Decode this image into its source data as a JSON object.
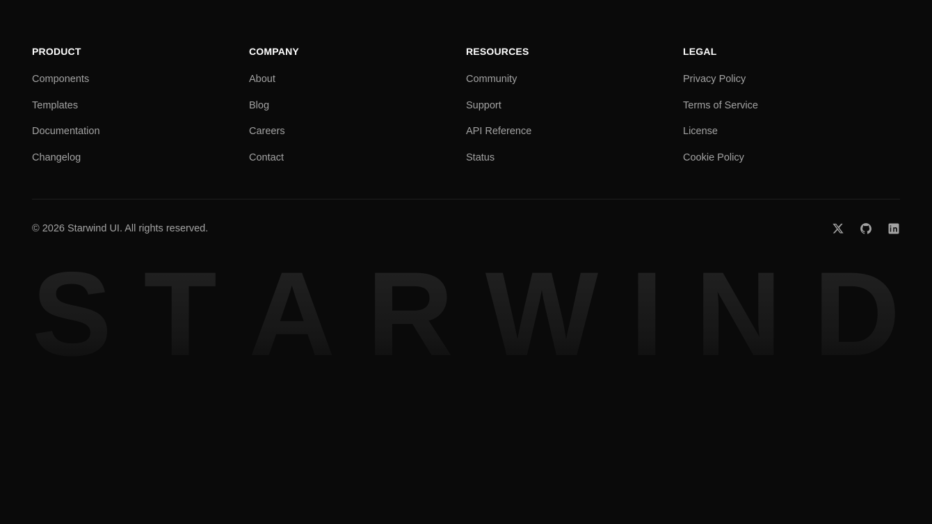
{
  "columns": [
    {
      "heading": "PRODUCT",
      "links": [
        "Components",
        "Templates",
        "Documentation",
        "Changelog"
      ]
    },
    {
      "heading": "COMPANY",
      "links": [
        "About",
        "Blog",
        "Careers",
        "Contact"
      ]
    },
    {
      "heading": "RESOURCES",
      "links": [
        "Community",
        "Support",
        "API Reference",
        "Status"
      ]
    },
    {
      "heading": "LEGAL",
      "links": [
        "Privacy Policy",
        "Terms of Service",
        "License",
        "Cookie Policy"
      ]
    }
  ],
  "copyright": "© 2026 Starwind UI. All rights reserved.",
  "socials": [
    {
      "icon": "x-icon"
    },
    {
      "icon": "github-icon"
    },
    {
      "icon": "linkedin-icon"
    }
  ],
  "wordmark": {
    "letters": [
      "S",
      "T",
      "A",
      "R",
      "W",
      "I",
      "N",
      "D"
    ]
  },
  "colors": {
    "background": "#0a0a0a",
    "heading": "#ffffff",
    "link": "#a3a3a3",
    "divider": "#1f1f1f",
    "wordmark": "#1c1c1c"
  }
}
